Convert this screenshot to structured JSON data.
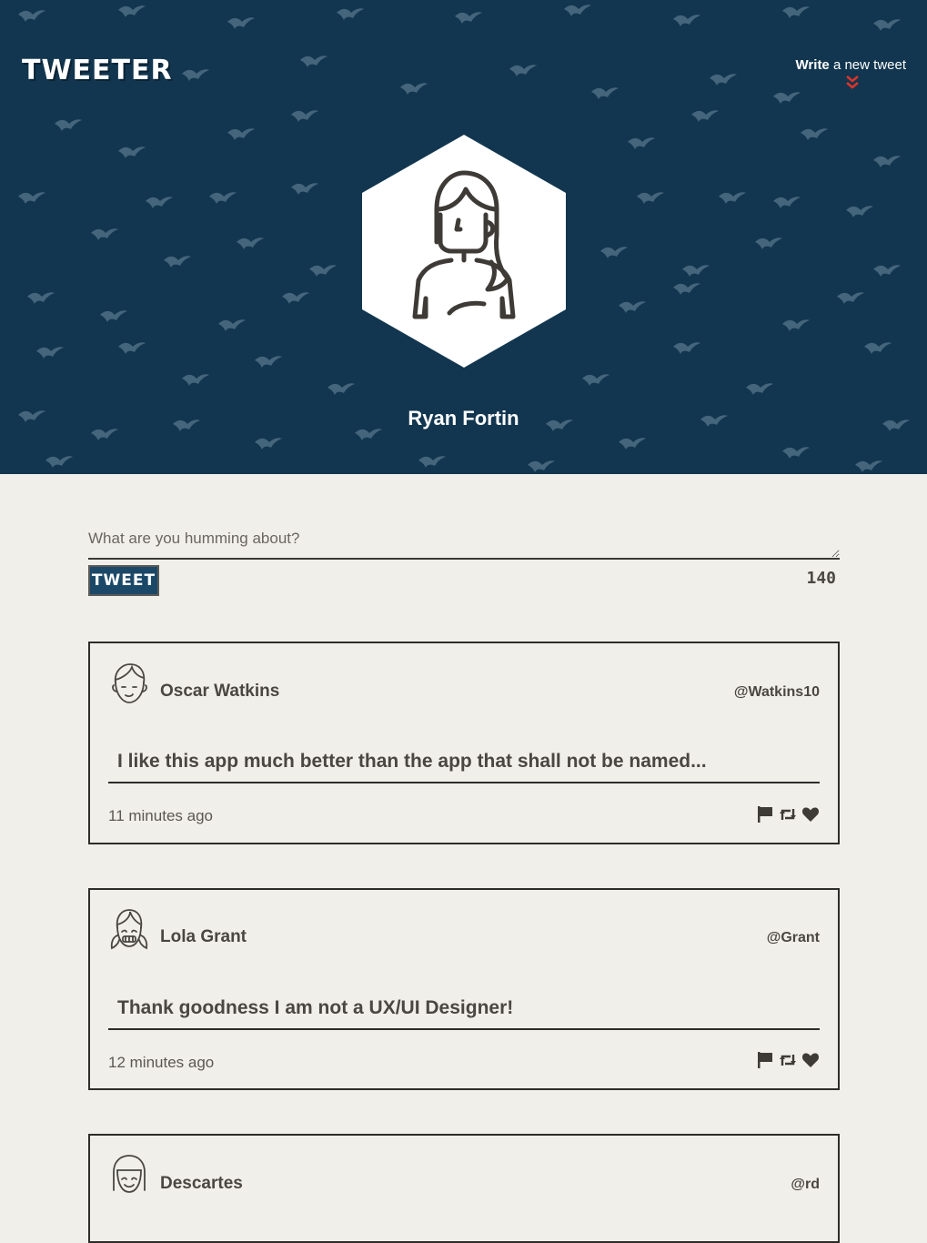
{
  "header": {
    "logo": "TWEETER",
    "compose_link_bold": "Write",
    "compose_link_rest": "a new tweet",
    "profile_name": "Ryan Fortin"
  },
  "composer": {
    "placeholder": "What are you humming about?",
    "value": "",
    "submit_label": "TWEET",
    "char_counter": "140"
  },
  "tweets": [
    {
      "name": "Oscar Watkins",
      "handle": "@Watkins10",
      "content": "I like this app much better than the app that shall not be named...",
      "time": "11 minutes ago"
    },
    {
      "name": "Lola Grant",
      "handle": "@Grant",
      "content": "Thank goodness I am not a UX/UI Designer!",
      "time": "12 minutes ago"
    },
    {
      "name": "Descartes",
      "handle": "@rd",
      "content": "",
      "time": ""
    }
  ],
  "icons": {
    "flag": "flag-icon",
    "retweet": "retweet-icon",
    "like": "heart-icon"
  },
  "colors": {
    "header_bg": "#12364f",
    "page_bg": "#f1efe9",
    "button_bg": "#1c4868",
    "accent_arrow": "#e0332b",
    "text": "#4a4743"
  }
}
